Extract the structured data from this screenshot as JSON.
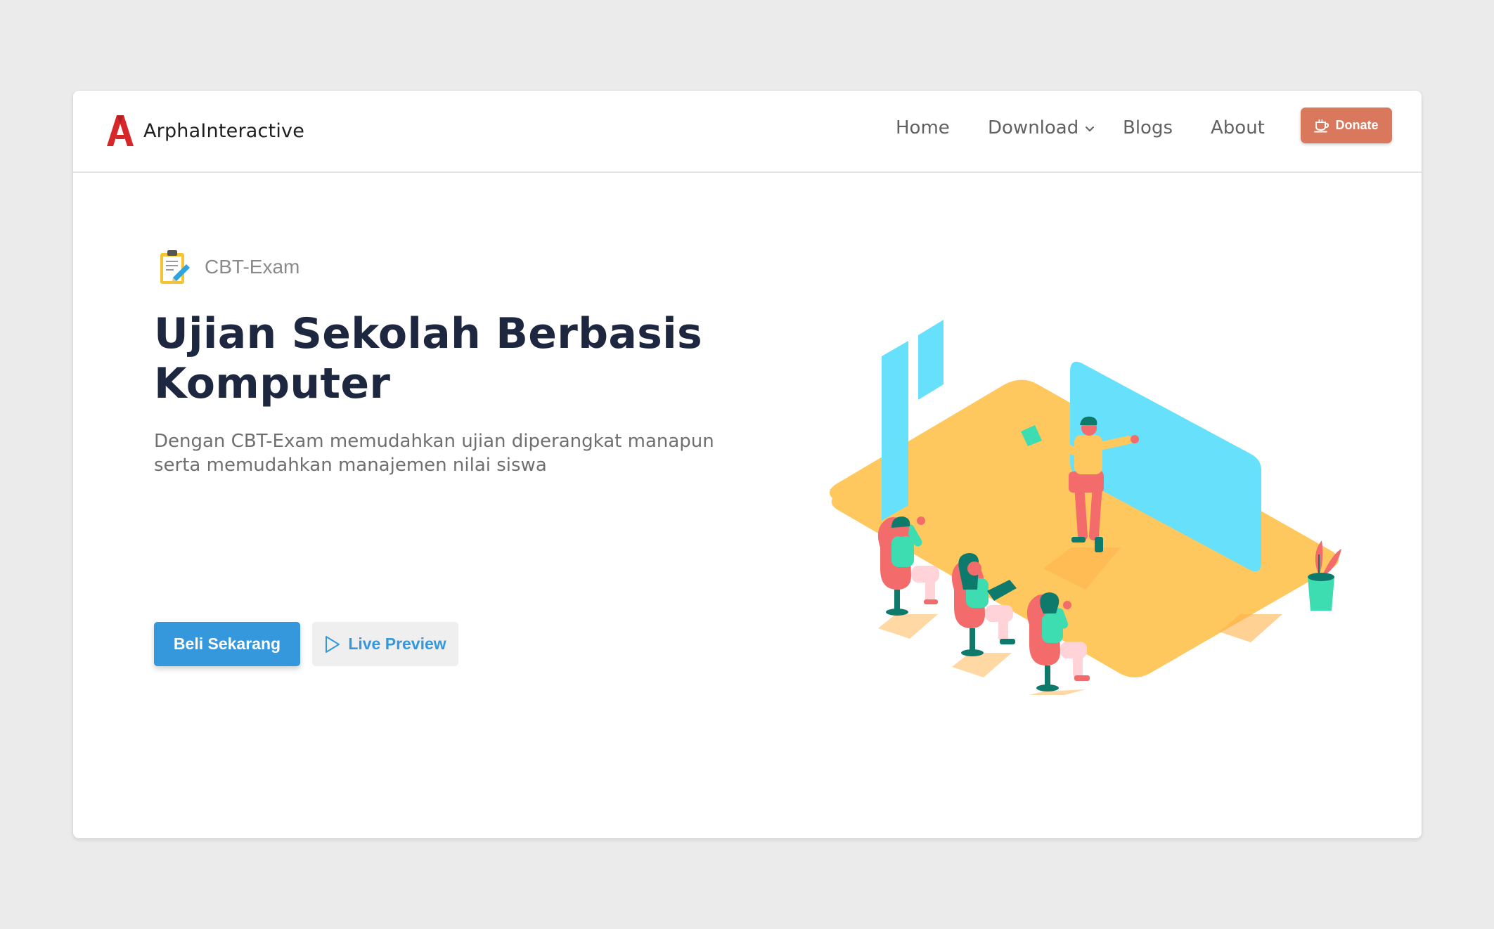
{
  "brand": {
    "name": "ArphaInteractive",
    "logo_icon": "arpha-a-logo-icon",
    "logo_color": "#d6272a"
  },
  "nav": {
    "items": [
      {
        "label": "Home"
      },
      {
        "label": "Download",
        "has_dropdown": true
      },
      {
        "label": "Blogs"
      },
      {
        "label": "About"
      }
    ],
    "donate": {
      "label": "Donate",
      "icon": "coffee-cup-icon",
      "color": "#d9785c"
    }
  },
  "hero": {
    "product_icon": "clipboard-pencil-icon",
    "product_name": "CBT-Exam",
    "title_line1": "Ujian Sekolah Berbasis",
    "title_line2": "Komputer",
    "description_line1": "Dengan CBT-Exam memudahkan ujian diperangkat manapun",
    "description_line2": "serta memudahkan manajemen nilai siswa",
    "primary_button": {
      "label": "Beli Sekarang",
      "color": "#3598dc"
    },
    "secondary_button": {
      "label": "Live Preview",
      "icon": "play-outline-icon"
    }
  },
  "colors": {
    "page_background": "#ebebeb",
    "title": "#1e2740",
    "muted_text": "#6f6f6f",
    "floor": "#ffc85f",
    "screen": "#66e0fb",
    "chair": "#f36b6b",
    "skin_teal": "#0e7a6b"
  },
  "illustration": {
    "name": "isometric-classroom-illustration"
  }
}
